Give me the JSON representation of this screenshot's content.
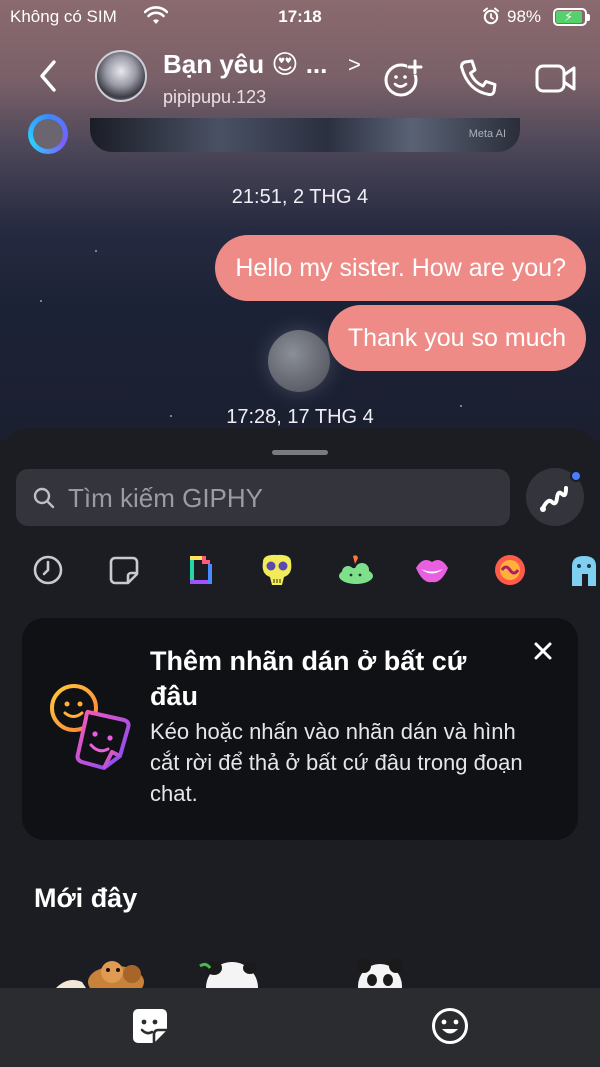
{
  "status_bar": {
    "carrier": "Không có SIM",
    "time": "17:18",
    "battery_percent": "98%",
    "battery_level": 0.98,
    "charging": true
  },
  "header": {
    "contact_name": "Bạn yêu 😍 ...",
    "chevron": ">",
    "username": "pipipupu.123",
    "icons": [
      "back-chevron-icon",
      "add-people-icon",
      "phone-icon",
      "video-camera-icon"
    ]
  },
  "conversation": {
    "preview_label": "Meta AI",
    "messages": [
      {
        "timestamp": "21:51, 2 THG 4",
        "text": "Hello my sister. How are you?"
      },
      {
        "timestamp": "",
        "text": "Thank you so much"
      }
    ],
    "last_timestamp": "17:28, 17 THG 4"
  },
  "colors": {
    "bubble": "#ee8b86",
    "sheet": "#1c1d22",
    "card": "#101114",
    "search": "#34353c",
    "accent_dot": "#4b7bff"
  },
  "sticker_sheet": {
    "search_placeholder": "Tìm kiếm GIPHY",
    "categories": [
      "recent-clock-icon",
      "sticker-icon",
      "giphy-logo-icon",
      "skull-sticker-icon",
      "cloud-sticker-icon",
      "lips-sticker-icon",
      "swirl-sticker-icon",
      "character-sticker-icon"
    ],
    "promo_card": {
      "title": "Thêm nhãn dán ở bất cứ đâu",
      "description": "Kéo hoặc nhấn vào nhãn dán và hình cắt rời để thả ở bất cứ đâu trong đoạn chat."
    },
    "recent_title": "Mới đây"
  },
  "tabs": [
    "sticker-tab-icon",
    "emoji-tab-icon"
  ]
}
